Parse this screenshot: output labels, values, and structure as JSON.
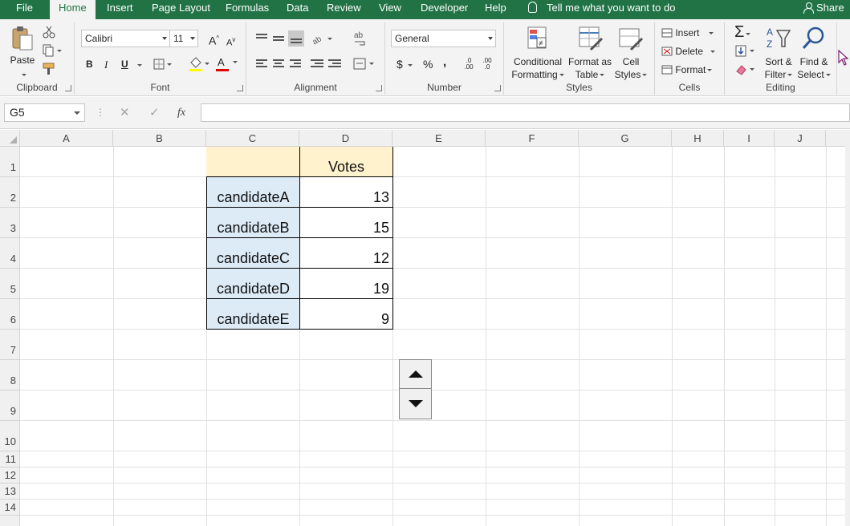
{
  "menu": {
    "tabs": [
      "File",
      "Home",
      "Insert",
      "Page Layout",
      "Formulas",
      "Data",
      "Review",
      "View",
      "Developer",
      "Help"
    ],
    "active_tab": "Home",
    "tell_me": "Tell me what you want to do",
    "share": "Share"
  },
  "ribbon": {
    "clipboard": {
      "label": "Clipboard",
      "paste": "Paste"
    },
    "font": {
      "label": "Font",
      "name": "Calibri",
      "size": "11",
      "bold": "B",
      "italic": "I",
      "underline": "U",
      "grow": "A",
      "shrink": "A",
      "font_color": "A"
    },
    "alignment": {
      "label": "Alignment"
    },
    "number": {
      "label": "Number",
      "format": "General",
      "currency": "$",
      "percent": "%",
      "comma": ",",
      "inc_decimal": ".0 .00",
      "dec_decimal": ".00 .0"
    },
    "styles": {
      "label": "Styles",
      "conditional_1": "Conditional",
      "conditional_2": "Formatting",
      "format_table_1": "Format as",
      "format_table_2": "Table",
      "cell_styles_1": "Cell",
      "cell_styles_2": "Styles"
    },
    "cells": {
      "label": "Cells",
      "insert": "Insert",
      "delete": "Delete",
      "format": "Format"
    },
    "editing": {
      "label": "Editing",
      "sort_1": "Sort &",
      "sort_2": "Filter",
      "find_1": "Find &",
      "find_2": "Select"
    }
  },
  "formula_bar": {
    "name_box": "G5",
    "fx": "fx",
    "value": ""
  },
  "sheet": {
    "columns": [
      "A",
      "B",
      "C",
      "D",
      "E",
      "F",
      "G",
      "H",
      "I",
      "J"
    ],
    "rows": [
      "1",
      "2",
      "3",
      "4",
      "5",
      "6",
      "7",
      "8",
      "9",
      "10",
      "11",
      "12",
      "13",
      "14"
    ],
    "table": {
      "header": "Votes",
      "candidates": [
        {
          "name": "candidateA",
          "votes": "13"
        },
        {
          "name": "candidateB",
          "votes": "15"
        },
        {
          "name": "candidateC",
          "votes": "12"
        },
        {
          "name": "candidateD",
          "votes": "19"
        },
        {
          "name": "candidateE",
          "votes": "9"
        }
      ]
    },
    "colors": {
      "header_fill": "#fff2cc",
      "name_fill": "#ddebf7",
      "ribbon_green": "#217346"
    }
  }
}
